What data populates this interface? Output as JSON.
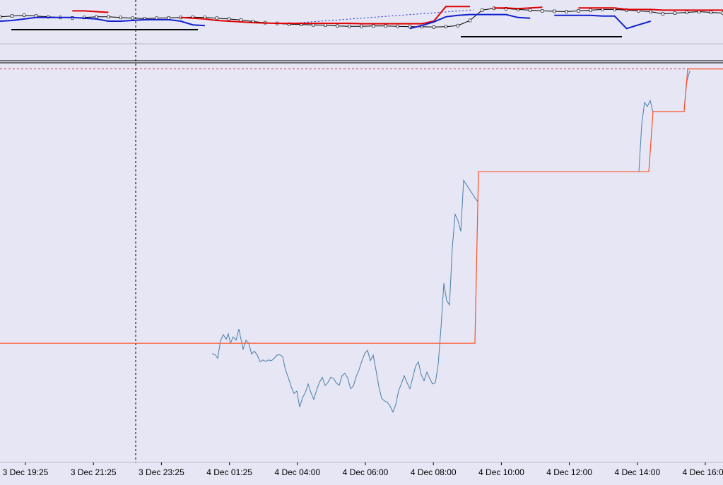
{
  "colors": {
    "background": "#e6e6f5",
    "price_line": "#4a7fa8",
    "step_line": "#ff5020",
    "upper_band": "#e00000",
    "lower_band": "#1020d0",
    "separator": "#000000",
    "crosshair": "#000000",
    "level_line": "#d04040"
  },
  "time_axis": {
    "labels": [
      "3 Dec 19:25",
      "3 Dec 21:25",
      "3 Dec 23:25",
      "4 Dec 01:25",
      "4 Dec 04:00",
      "4 Dec 06:00",
      "4 Dec 08:00",
      "4 Dec 10:00",
      "4 Dec 12:00",
      "4 Dec 14:00",
      "4 Dec 16:00"
    ]
  },
  "chart_data": [
    {
      "type": "line",
      "panel": "overview",
      "title": "",
      "grid": false,
      "legend": "none",
      "description_hidden": true,
      "series": [
        {
          "role": "price",
          "values": [
            0.62,
            0.64,
            0.66,
            0.64,
            0.62,
            0.6,
            0.59,
            0.6,
            0.62,
            0.62,
            0.6,
            0.58,
            0.57,
            0.58,
            0.59,
            0.6,
            0.61,
            0.6,
            0.58,
            0.56,
            0.53,
            0.49,
            0.46,
            0.44,
            0.42,
            0.41,
            0.4,
            0.39,
            0.37,
            0.36,
            0.36,
            0.37,
            0.37,
            0.36,
            0.35,
            0.35,
            0.34,
            0.35,
            0.38,
            0.52,
            0.8,
            0.85,
            0.84,
            0.82,
            0.8,
            0.78,
            0.77,
            0.76,
            0.78,
            0.8,
            0.82,
            0.82,
            0.8,
            0.78,
            0.76,
            0.7,
            0.72,
            0.74,
            0.76,
            0.74,
            0.72
          ]
        },
        {
          "role": "upper",
          "values": [
            null,
            null,
            null,
            null,
            null,
            null,
            0.78,
            0.78,
            0.76,
            0.74,
            null,
            null,
            null,
            null,
            null,
            0.6,
            0.58,
            0.56,
            0.52,
            0.5,
            0.48,
            0.46,
            0.45,
            0.44,
            0.44,
            0.44,
            0.44,
            0.44,
            0.44,
            0.44,
            0.43,
            0.43,
            0.43,
            0.43,
            0.43,
            0.43,
            0.5,
            0.9,
            0.9,
            0.9,
            null,
            0.86,
            0.86,
            0.84,
            0.86,
            0.88,
            null,
            null,
            0.86,
            0.86,
            0.86,
            0.86,
            0.82,
            0.82,
            0.82,
            0.8,
            0.8,
            0.8,
            0.8,
            0.8,
            0.8
          ]
        },
        {
          "role": "lower",
          "values": [
            0.5,
            0.52,
            0.56,
            0.6,
            0.6,
            0.6,
            0.6,
            0.58,
            0.56,
            0.5,
            0.5,
            0.52,
            0.54,
            0.54,
            0.54,
            0.5,
            0.4,
            0.38,
            null,
            null,
            null,
            null,
            null,
            null,
            null,
            null,
            null,
            null,
            null,
            null,
            null,
            null,
            null,
            null,
            0.3,
            0.38,
            0.48,
            0.62,
            0.66,
            0.68,
            0.68,
            0.68,
            0.68,
            0.6,
            0.58,
            null,
            0.66,
            0.66,
            0.66,
            0.66,
            0.64,
            0.64,
            0.3,
            0.4,
            0.5,
            null,
            null,
            null,
            null,
            null,
            null
          ]
        }
      ]
    },
    {
      "type": "line",
      "panel": "main",
      "title": "",
      "xlabel": "",
      "ylabel": "",
      "grid": false,
      "legend": "none",
      "y_axis_labels_visible": false,
      "ylim": [
        0,
        100
      ],
      "x_range": [
        0,
        1023
      ],
      "reference_level": 99.0,
      "crosshair_x": 192,
      "series": [
        {
          "role": "price",
          "x": [
            300,
            305,
            308,
            312,
            316,
            320,
            323,
            326,
            330,
            334,
            338,
            341,
            344,
            348,
            352,
            356,
            360,
            364,
            368,
            372,
            376,
            380,
            384,
            388,
            392,
            396,
            400,
            404,
            408,
            412,
            416,
            420,
            424,
            428,
            432,
            436,
            440,
            444,
            448,
            452,
            456,
            460,
            464,
            468,
            472,
            476,
            480,
            484,
            488,
            492,
            496,
            500,
            504,
            508,
            512,
            516,
            520,
            524,
            528,
            532,
            536,
            540,
            544,
            548,
            552,
            556,
            560,
            564,
            568,
            572,
            576,
            580,
            584,
            588,
            592,
            596,
            600,
            604,
            608,
            612,
            616,
            620,
            624,
            628,
            632,
            636,
            640,
            644,
            648,
            652,
            656,
            660,
            664,
            668,
            672,
            676
          ],
          "y": [
            27.0,
            26.6,
            25.8,
            30.2,
            31.8,
            30.6,
            32.0,
            29.6,
            31.2,
            30.4,
            33.2,
            30.6,
            28.1,
            30.4,
            29.6,
            26.9,
            27.6,
            26.6,
            24.9,
            25.4,
            25.0,
            25.4,
            25.2,
            25.8,
            26.6,
            26.7,
            26.2,
            22.8,
            20.9,
            18.6,
            16.9,
            17.5,
            13.5,
            15.8,
            17.1,
            19.3,
            17.1,
            15.4,
            17.8,
            19.7,
            21.0,
            18.9,
            19.7,
            21.0,
            20.7,
            19.5,
            19.0,
            21.4,
            22.0,
            20.8,
            18.1,
            18.8,
            21.2,
            22.9,
            25.1,
            27.0,
            27.8,
            25.2,
            26.6,
            22.8,
            18.7,
            15.7,
            15.0,
            14.7,
            13.7,
            12.2,
            14.1,
            17.6,
            19.4,
            21.4,
            19.6,
            18.1,
            20.9,
            23.8,
            24.9,
            21.6,
            20.1,
            22.3,
            20.7,
            19.3,
            19.6,
            24.2,
            33.6,
            44.8,
            40.4,
            39.3,
            53.9,
            62.2,
            60.6,
            57.9,
            70.8,
            69.7,
            68.6,
            67.5,
            66.4,
            65.4
          ]
        },
        {
          "role": "price",
          "x": [
            904,
            908,
            912,
            916,
            920,
            924
          ],
          "y": [
            73.0,
            85.0,
            90.5,
            89.5,
            91.0,
            88.0
          ]
        },
        {
          "role": "price",
          "x": [
            968,
            972,
            976
          ],
          "y": [
            89.0,
            96.0,
            98.5
          ]
        },
        {
          "role": "step",
          "x": [
            0,
            672,
            677,
            904,
            918,
            924,
            968,
            973,
            1023
          ],
          "y": [
            29.6,
            29.6,
            73.0,
            73.0,
            73.0,
            88.2,
            88.2,
            99.0,
            99.0
          ]
        }
      ]
    }
  ]
}
